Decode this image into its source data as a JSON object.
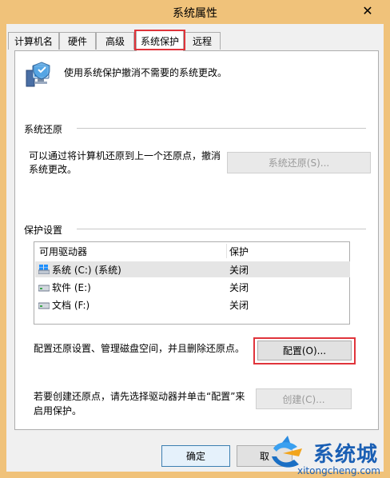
{
  "window": {
    "title": "系统属性",
    "close_glyph": "✕"
  },
  "tabs": [
    {
      "label": "计算机名"
    },
    {
      "label": "硬件"
    },
    {
      "label": "高级"
    },
    {
      "label": "系统保护"
    },
    {
      "label": "远程"
    }
  ],
  "intro": {
    "text": "使用系统保护撤消不需要的系统更改。"
  },
  "restore": {
    "group_title": "系统还原",
    "description_line1": "可以通过将计算机还原到上一个还原点，撤消",
    "description_line2": "系统更改。",
    "button_label": "系统还原(S)..."
  },
  "protection": {
    "group_title": "保护设置",
    "columns": [
      "可用驱动器",
      "保护"
    ],
    "drives": [
      {
        "name": "系统 (C:) (系统)",
        "protection": "关闭",
        "icon": "windows-drive-icon"
      },
      {
        "name": "软件 (E:)",
        "protection": "关闭",
        "icon": "drive-icon"
      },
      {
        "name": "文档 (F:)",
        "protection": "关闭",
        "icon": "drive-icon"
      }
    ],
    "configure_text": "配置还原设置、管理磁盘空间，并且删除还原点。",
    "configure_button": "配置(O)...",
    "create_text_line1": "若要创建还原点，请先选择驱动器并单击“配置”来",
    "create_text_line2": "启用保护。",
    "create_button": "创建(C)..."
  },
  "footer": {
    "ok_label": "确定",
    "cancel_label": "取"
  },
  "watermark": {
    "brand": "系统城",
    "site": "xitongcheng.com"
  },
  "colors": {
    "title_bar": "#f0c27a",
    "highlight": "#e0343b",
    "brand_blue": "#1a5fb4"
  }
}
